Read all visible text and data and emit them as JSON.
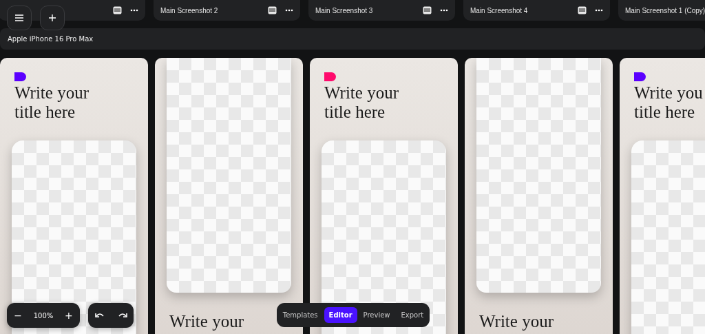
{
  "tabs": [
    {
      "selected": false
    },
    {
      "label": "Main Screenshot 2",
      "selected": false
    },
    {
      "label": "Main Screenshot 3",
      "selected": false
    },
    {
      "label": "Main Screenshot 4",
      "selected": false
    },
    {
      "label": "Main Screenshot 1 (Copy)",
      "selected": false
    }
  ],
  "device": {
    "label": "Apple iPhone 16 Pro Max"
  },
  "screens": [
    {
      "kind": "title-top",
      "title_lines": [
        "Write your",
        "title here"
      ],
      "color": "#5b00ff"
    },
    {
      "kind": "phone-top",
      "title_lines": [
        "Write your"
      ]
    },
    {
      "kind": "title-top",
      "title_lines": [
        "Write your",
        "title here"
      ],
      "color": "#ff0a6c"
    },
    {
      "kind": "phone-top",
      "title_lines": [
        "Write your"
      ]
    },
    {
      "kind": "title-top",
      "title_lines": [
        "Write you",
        "title here"
      ],
      "color": "#5b00ff"
    }
  ],
  "zoom": {
    "minus": "−",
    "value": "100%",
    "plus": "+"
  },
  "nav": [
    {
      "label": "Templates",
      "selected": false
    },
    {
      "label": "Editor",
      "selected": true
    },
    {
      "label": "Preview",
      "selected": false
    },
    {
      "label": "Export",
      "selected": false
    }
  ]
}
